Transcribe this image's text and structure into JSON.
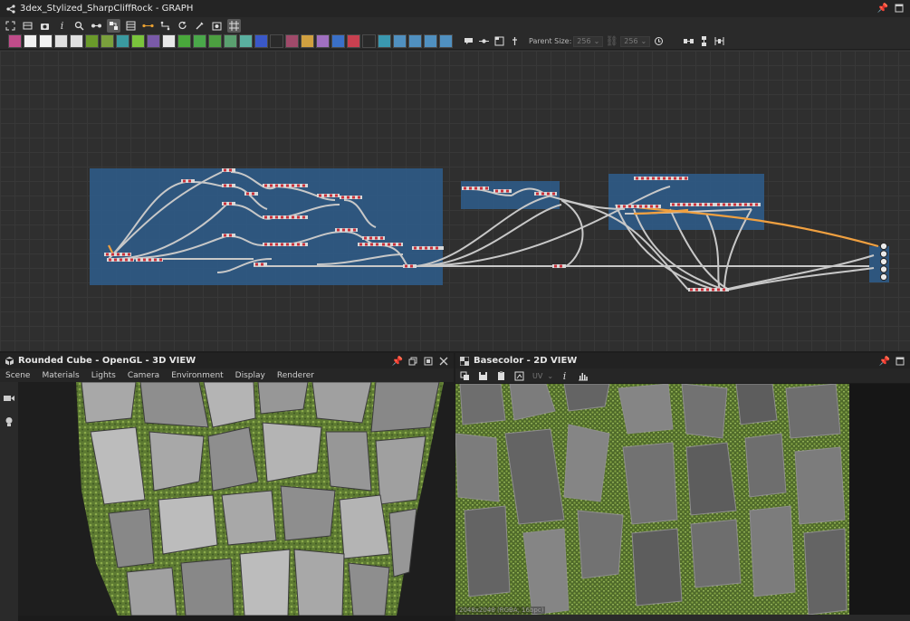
{
  "graph": {
    "title": "3dex_Stylized_SharpCliffRock - GRAPH",
    "toolbar1_icons": [
      "fit-view-icon",
      "frame-icon",
      "camera-icon",
      "info-icon",
      "search-icon",
      "swap-icon",
      "align-icon",
      "layout-icon",
      "connector-icon",
      "path-icon",
      "refresh-icon",
      "tools-icon",
      "export-icon",
      "grid-icon"
    ],
    "node_buttons": [
      {
        "icon": "bitmap-icon",
        "color": "#c04c8a"
      },
      {
        "icon": "svg-icon",
        "color": "#f2f2f2"
      },
      {
        "icon": "text-icon",
        "color": "#f2f2f2"
      },
      {
        "icon": "drop-icon",
        "color": "#e0e0e0"
      },
      {
        "icon": "shuffle-icon",
        "color": "#e0e0e0"
      },
      {
        "icon": "curve-icon",
        "color": "#6a9a2a"
      },
      {
        "icon": "levels-icon",
        "color": "#7aa03c"
      },
      {
        "icon": "warp-icon",
        "color": "#3a9aa0"
      },
      {
        "icon": "gradient-icon",
        "color": "#7ac43c"
      },
      {
        "icon": "blend-icon",
        "color": "#7a5aa8"
      },
      {
        "icon": "grid-pattern-icon",
        "color": "#e8e8e8"
      },
      {
        "icon": "tile-icon",
        "color": "#49a83b"
      },
      {
        "icon": "splatter-icon",
        "color": "#4aa84a"
      },
      {
        "icon": "noise-icon",
        "color": "#4ca040"
      },
      {
        "icon": "sphere-icon",
        "color": "#5aa070"
      },
      {
        "icon": "shape-icon",
        "color": "#5ab0a0"
      },
      {
        "icon": "swirl-icon",
        "color": "#3a58c8"
      },
      {
        "icon": "fx-icon",
        "color": "#2a2a2a"
      },
      {
        "icon": "histogram-icon",
        "color": "#a04a6a"
      },
      {
        "icon": "triangle-icon",
        "color": "#d0a040"
      },
      {
        "icon": "letter-a-icon",
        "color": "#a070c0"
      },
      {
        "icon": "transform-icon",
        "color": "#3a70c8"
      },
      {
        "icon": "paint-icon",
        "color": "#c84050"
      },
      {
        "icon": "value-icon",
        "color": "#2a2a2a"
      },
      {
        "icon": "function-node-icon",
        "color": "#3a98b0"
      },
      {
        "icon": "input-node-icon",
        "color": "#5090c0"
      },
      {
        "icon": "output-node-icon",
        "color": "#5090c0"
      },
      {
        "icon": "graph-node-icon",
        "color": "#5090c0"
      },
      {
        "icon": "comment-node-icon",
        "color": "#5090c0"
      }
    ],
    "toolbar2_right_icons": [
      "comment-icon",
      "pin-icon",
      "frame-node-icon",
      "anchor-icon"
    ],
    "parent_size_label": "Parent Size:",
    "parent_size_w": "256",
    "parent_size_h": "256",
    "right_icons": [
      "link-icon",
      "reset-icon",
      "align-h-icon",
      "align-v-icon",
      "distribute-icon"
    ],
    "frames": [
      {
        "name": "frame-main"
      },
      {
        "name": "frame-small"
      },
      {
        "name": "frame-right"
      },
      {
        "name": "frame-output"
      }
    ]
  },
  "view3d": {
    "title": "Rounded Cube - OpenGL - 3D VIEW",
    "menu": [
      "Scene",
      "Materials",
      "Lights",
      "Camera",
      "Environment",
      "Display",
      "Renderer"
    ],
    "side_icons": [
      "video-camera-icon",
      "light-bulb-icon"
    ]
  },
  "view2d": {
    "title": "Basecolor - 2D VIEW",
    "toolbar_icons": [
      "copy-icon",
      "save-icon",
      "paste-icon",
      "export-image-icon"
    ],
    "uv_label": "UV",
    "resolution_label": "2048x2048 (RGBA, 16bpc)"
  },
  "colors": {
    "frame_fill": "#2f5a86",
    "wire": "#c8c8c8",
    "wire_highlight": "#f0a040",
    "port_red": "#c8303a",
    "rock_light": "#9a9a9a",
    "moss": "#6e8a3c"
  }
}
